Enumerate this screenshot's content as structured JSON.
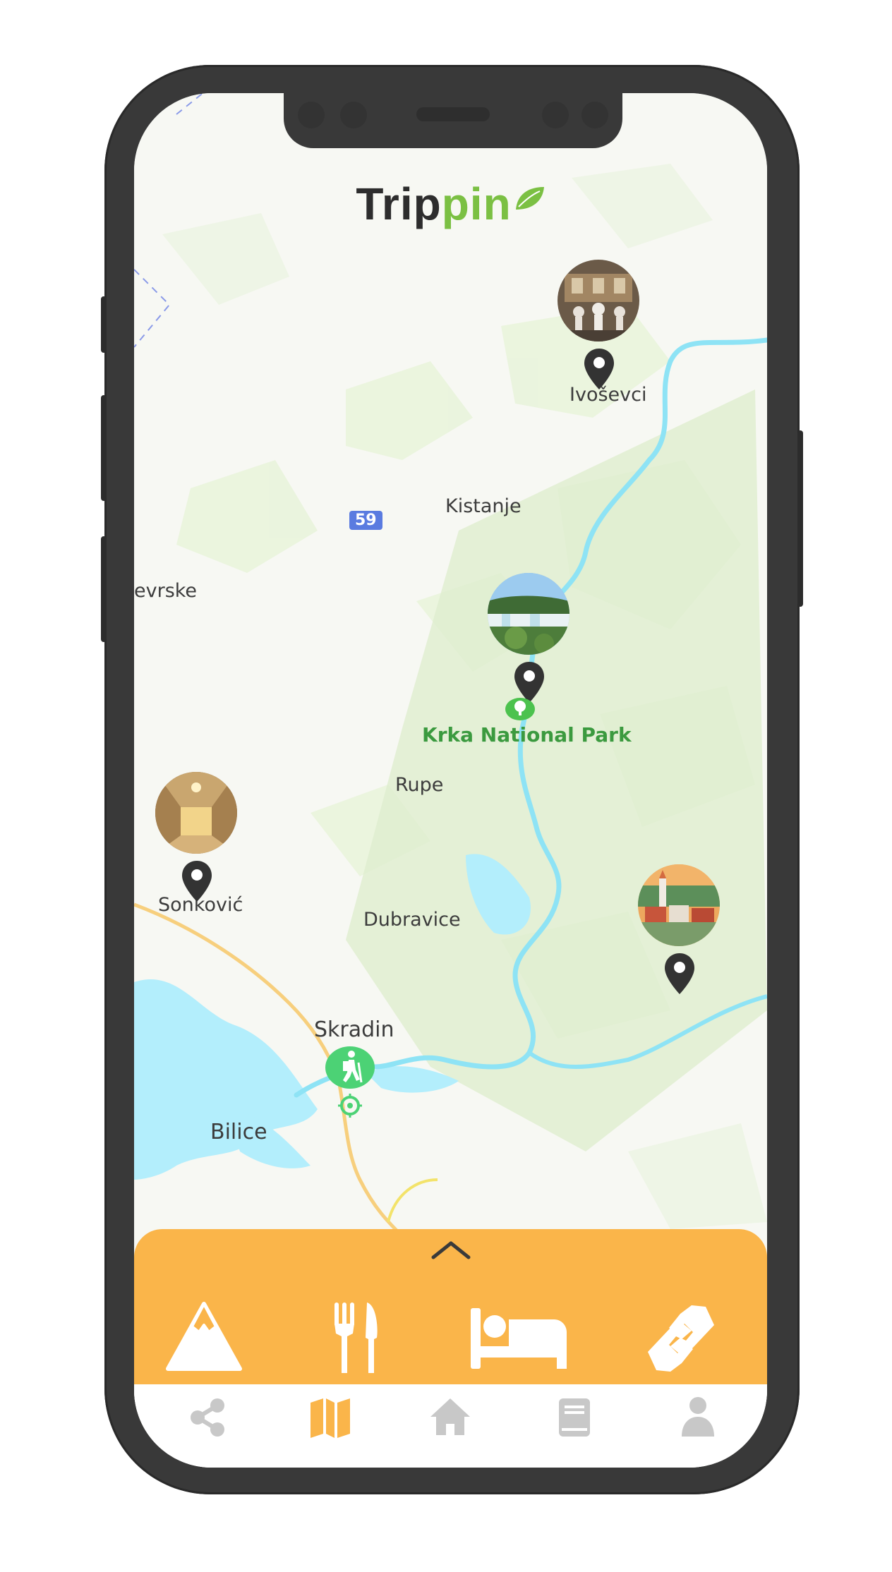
{
  "app": {
    "logo_part1": "Trip",
    "logo_part2": "pin",
    "brand_green": "#7bc043",
    "accent_orange": "#fab54a"
  },
  "map": {
    "labels": {
      "ivosevci": "Ivoševci",
      "kistanje": "Kistanje",
      "road_59": "59",
      "evrske": "evrske",
      "krka": "Krka National Park",
      "rupe": "Rupe",
      "sonkovic": "Sonković",
      "dubravice": "Dubravice",
      "skradin": "Skradin",
      "bilice": "Bilice"
    },
    "pois": [
      {
        "name": "museum-poi",
        "icon": "map-pin-icon"
      },
      {
        "name": "waterfall-poi",
        "icon": "map-pin-icon"
      },
      {
        "name": "palace-hall-poi",
        "icon": "map-pin-icon"
      },
      {
        "name": "town-poi",
        "icon": "map-pin-icon"
      }
    ],
    "markers": [
      "park-tree-icon",
      "hiking-icon",
      "location-target-icon"
    ]
  },
  "drawer": {
    "toggle_icon": "chevron-up-icon",
    "categories": [
      {
        "name": "mountain",
        "icon": "mountain-icon"
      },
      {
        "name": "food",
        "icon": "fork-knife-icon"
      },
      {
        "name": "accommodation",
        "icon": "bed-icon"
      },
      {
        "name": "partnership",
        "icon": "handshake-icon"
      }
    ]
  },
  "tabbar": {
    "items": [
      {
        "name": "share",
        "icon": "share-icon",
        "active": false
      },
      {
        "name": "map",
        "icon": "map-icon",
        "active": true
      },
      {
        "name": "home",
        "icon": "home-icon",
        "active": false
      },
      {
        "name": "guide",
        "icon": "book-icon",
        "active": false
      },
      {
        "name": "profile",
        "icon": "user-icon",
        "active": false
      }
    ],
    "active_color": "#fab54a",
    "inactive_color": "#c8c8c8"
  }
}
